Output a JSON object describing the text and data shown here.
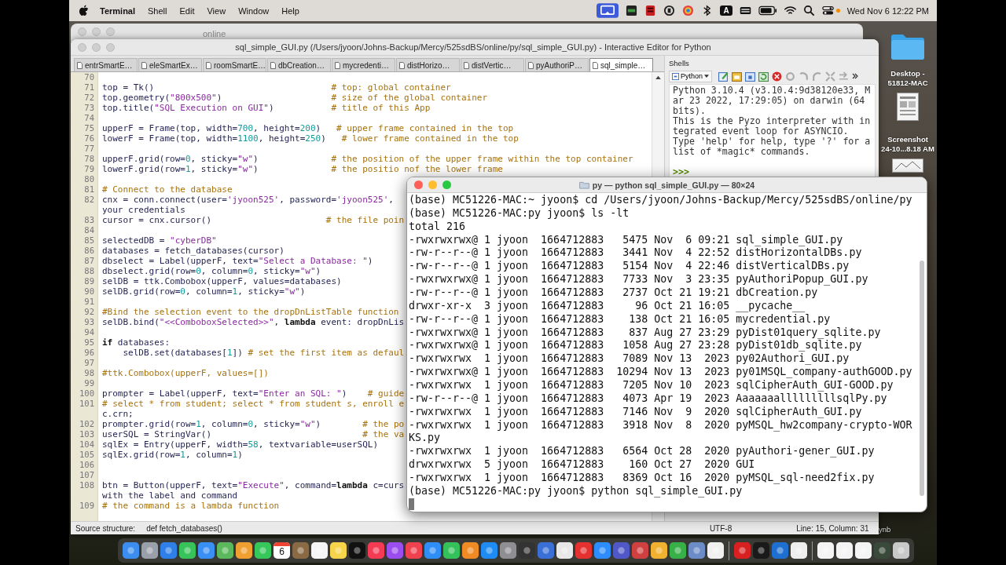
{
  "menu_bar": {
    "app": "Terminal",
    "items": [
      "Shell",
      "Edit",
      "View",
      "Window",
      "Help"
    ],
    "input_source": "A",
    "clock": "Wed Nov 6  12:22 PM"
  },
  "back_window": {
    "title": "online"
  },
  "editor": {
    "title": "sql_simple_GUI.py (/Users/jyoon/Johns-Backup/Mercy/525sdBS/online/py/sql_simple_GUI.py) - Interactive Editor for Python",
    "tabs": [
      {
        "label": "entrSmartE…",
        "selected": false
      },
      {
        "label": "eleSmartEx…",
        "selected": false
      },
      {
        "label": "roomSmartE…",
        "selected": false
      },
      {
        "label": "dbCreation…",
        "selected": false
      },
      {
        "label": "mycredenti…",
        "selected": false
      },
      {
        "label": "distHorizo…",
        "selected": false
      },
      {
        "label": "distVertic…",
        "selected": false
      },
      {
        "label": "pyAuthoriP…",
        "selected": false
      },
      {
        "label": "sql_simple…",
        "selected": true
      }
    ],
    "lines": [
      {
        "number": "70"
      },
      {
        "number": "71",
        "text": "top = Tk()                                  # top: global container"
      },
      {
        "number": "72",
        "text": "top.geometry(\"800x500\")                     # size of the global container"
      },
      {
        "number": "73",
        "text": "top.title(\"SQL Execution on GUI\")           # title of this App"
      },
      {
        "number": "74"
      },
      {
        "number": "75",
        "text": "upperF = Frame(top, width=700, height=200)   # upper frame contained in the top"
      },
      {
        "number": "76",
        "text": "lowerF = Frame(top, width=1100, height=250)   # lower frame contained in the top"
      },
      {
        "number": "77"
      },
      {
        "number": "78",
        "text": "upperF.grid(row=0, sticky=\"w\")              # the position of the upper frame within the top container"
      },
      {
        "number": "79",
        "text": "lowerF.grid(row=1, sticky=\"w\")              # the positio nof the lower frame"
      },
      {
        "number": "80"
      },
      {
        "number": "81",
        "text": "# Connect to the database"
      },
      {
        "number": "82",
        "text": "cnx = conn.connect(user='jyoon525', password='jyoon525',",
        "continuation": "your credentials"
      },
      {
        "number": "83",
        "text": "cursor = cnx.cursor()                      # the file poin"
      },
      {
        "number": "84"
      },
      {
        "number": "85",
        "text": "selectedDB = \"cyberDB\""
      },
      {
        "number": "86",
        "text": "databases = fetch_databases(cursor)"
      },
      {
        "number": "87",
        "text": "dbselect = Label(upperF, text=\"Select a Database: \")"
      },
      {
        "number": "88",
        "text": "dbselect.grid(row=0, column=0, sticky=\"w\")"
      },
      {
        "number": "89",
        "text": "selDB = ttk.Combobox(upperF, values=databases)"
      },
      {
        "number": "90",
        "text": "selDB.grid(row=0, column=1, sticky=\"w\")"
      },
      {
        "number": "91"
      },
      {
        "number": "92",
        "text": "#Bind the selection event to the dropDnListTable function"
      },
      {
        "number": "93",
        "text": "selDB.bind(\"<<ComboboxSelected>>\", **lambda** event: dropDnLis"
      },
      {
        "number": "94"
      },
      {
        "number": "95",
        "text": "**if** databases:"
      },
      {
        "number": "96",
        "text": "    selDB.set(databases[1]) # set the first item as defaul"
      },
      {
        "number": "97"
      },
      {
        "number": "98",
        "text": "#ttk.Combobox(upperF, values=[])"
      },
      {
        "number": "99"
      },
      {
        "number": "100",
        "text": "prompter = Label(upperF, text=\"Enter an SQL: \")    # guide"
      },
      {
        "number": "101",
        "text": "# select * from student; select * from student s, enroll e",
        "continuation": "c.crn;"
      },
      {
        "number": "102",
        "text": "prompter.grid(row=1, column=0, sticky=\"w\")        # the po"
      },
      {
        "number": "103",
        "text": "userSQL = StringVar()                             # the va"
      },
      {
        "number": "104",
        "text": "sqlEx = Entry(upperF, width=58, textvariable=userSQL)"
      },
      {
        "number": "105",
        "text": "sqlEx.grid(row=1, column=1)"
      },
      {
        "number": "106"
      },
      {
        "number": "107"
      },
      {
        "number": "108",
        "text": "btn = Button(upperF, text=\"Execute\", command=**lambda** c=curs",
        "continuation": "with the label and command"
      },
      {
        "number": "109",
        "text": "# the command is a lambda function"
      }
    ],
    "status": {
      "label": "Source structure:",
      "value": "def fetch_databases()",
      "encoding": "UTF-8",
      "position": "Line: 15, Column: 31"
    }
  },
  "shells": {
    "title": "Shells",
    "shell_menu": "Python",
    "output": [
      "Python 3.10.4 (v3.10.4:9d38120e33, M",
      "ar 23 2022, 17:29:05) on darwin (64",
      "bits).",
      "This is the Pyzo interpreter with in",
      "tegrated event loop for ASYNCIO.",
      "Type 'help' for help, type '?' for a",
      "list of *magic* commands."
    ],
    "prompt": ">>>"
  },
  "terminal": {
    "title": "py — python sql_simple_GUI.py — 80×24",
    "lines": [
      "(base) MC51226-MAC:~ jyoon$ cd /Users/jyoon/Johns-Backup/Mercy/525sdBS/online/py",
      "(base) MC51226-MAC:py jyoon$ ls -lt",
      "total 216",
      "-rwxrwxrwx@ 1 jyoon  1664712883   5475 Nov  6 09:21 sql_simple_GUI.py",
      "-rw-r--r--@ 1 jyoon  1664712883   3441 Nov  4 22:52 distHorizontalDBs.py",
      "-rw-r--r--@ 1 jyoon  1664712883   5154 Nov  4 22:46 distVerticalDBs.py",
      "-rwxrwxrwx@ 1 jyoon  1664712883   7733 Nov  3 23:35 pyAuthoriPopup_GUI.py",
      "-rw-r--r--@ 1 jyoon  1664712883   2737 Oct 21 19:21 dbCreation.py",
      "drwxr-xr-x  3 jyoon  1664712883     96 Oct 21 16:05 __pycache__",
      "-rw-r--r--@ 1 jyoon  1664712883    138 Oct 21 16:05 mycredential.py",
      "-rwxrwxrwx@ 1 jyoon  1664712883    837 Aug 27 23:29 pyDist01query_sqlite.py",
      "-rwxrwxrwx@ 1 jyoon  1664712883   1058 Aug 27 23:28 pyDist01db_sqlite.py",
      "-rwxrwxrwx  1 jyoon  1664712883   7089 Nov 13  2023 py02Authori_GUI.py",
      "-rwxrwxrwx@ 1 jyoon  1664712883  10294 Nov 13  2023 py01MSQL_company-authGOOD.py",
      "-rwxrwxrwx  1 jyoon  1664712883   7205 Nov 10  2023 sqlCipherAuth_GUI-GOOD.py",
      "-rw-r--r--@ 1 jyoon  1664712883   4073 Apr 19  2023 AaaaaaalllllllllsqlPy.py",
      "-rwxrwxrwx  1 jyoon  1664712883   7146 Nov  9  2020 sqlCipherAuth_GUI.py",
      "-rwxrwxrwx  1 jyoon  1664712883   3918 Nov  8  2020 pyMSQL_hw2company-crypto-WOR",
      "KS.py",
      "-rwxrwxrwx  1 jyoon  1664712883   6564 Oct 28  2020 pyAuthori-gener_GUI.py",
      "drwxrwxrwx  5 jyoon  1664712883    160 Oct 27  2020 GUI",
      "-rwxrwxrwx  1 jyoon  1664712883   8369 Oct 16  2020 pyMSQL_sql-need2fix.py",
      "(base) MC51226-MAC:py jyoon$ python sql_simple_GUI.py"
    ]
  },
  "desktop_icons": [
    {
      "kind": "folder",
      "lines": [
        "Desktop -",
        "51812-MAC"
      ]
    },
    {
      "kind": "document",
      "lines": [
        "Screenshot",
        "24-10...8.18 AM"
      ]
    },
    {
      "kind": "thumbnail"
    },
    {
      "kind": "label",
      "lines": [
        "ynb"
      ]
    }
  ],
  "dock": {
    "calendar_day": "6"
  }
}
